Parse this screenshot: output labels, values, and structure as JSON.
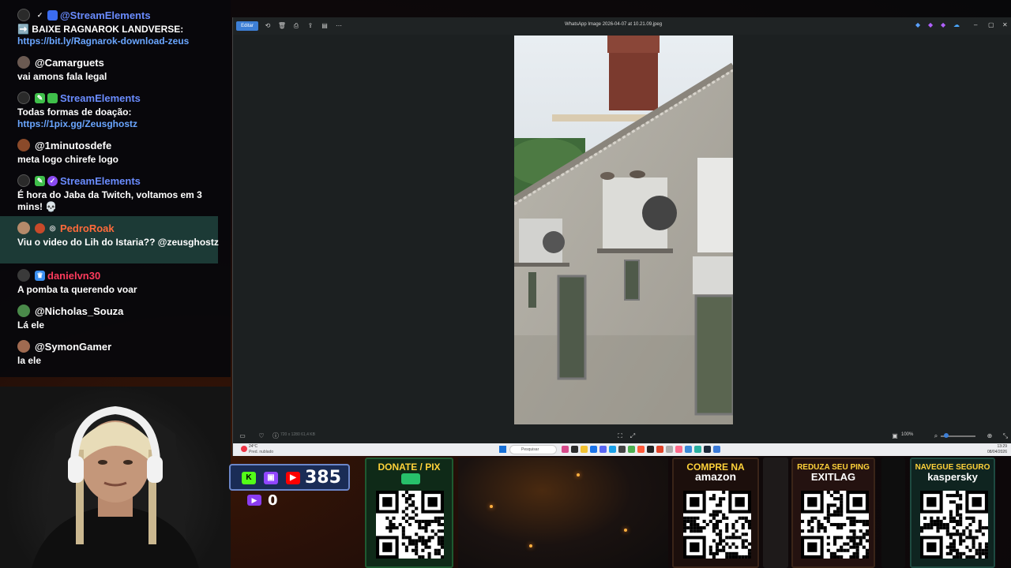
{
  "chat": {
    "messages": [
      {
        "user": "@StreamElements",
        "user_color": "#6a8cff",
        "text": "➡️ BAIXE RAGNAROK LANDVERSE:",
        "link": "https://bit.ly/Ragnarok-download-zeus"
      },
      {
        "user": "@Camarguets",
        "user_color": "#ffffff",
        "text": "vai amons fala legal",
        "link": ""
      },
      {
        "user": "StreamElements",
        "user_color": "#6a8cff",
        "text": "Todas formas de doação:",
        "link": "https://1pix.gg/Zeusghostz"
      },
      {
        "user": "@1minutosdefe",
        "user_color": "#ffffff",
        "text": "meta logo chirefe logo",
        "link": ""
      },
      {
        "user": "StreamElements",
        "user_color": "#6a8cff",
        "text": "É hora do Jaba da Twitch, voltamos em 3 mins! 💀",
        "link": ""
      },
      {
        "user": "PedroRoak",
        "user_color": "#ff6a3a",
        "text": "Viu o video do Lih do Istaria?? @zeusghostz",
        "link": ""
      },
      {
        "user": "danielvn30",
        "user_color": "#ff3b5c",
        "text": "A pomba ta querendo voar",
        "link": ""
      },
      {
        "user": "@Nicholas_Souza",
        "user_color": "#ffffff",
        "text": "Lá ele",
        "link": ""
      },
      {
        "user": "@SymonGamer",
        "user_color": "#ffffff",
        "text": "la ele",
        "link": ""
      }
    ]
  },
  "viewer": {
    "edit_label": "Editar",
    "file_title": "WhatsApp Image 2026-04-07 at 10.21.09.jpeg",
    "dims": "720 x 1280   61,4 KB",
    "zoom": "100%"
  },
  "taskbar": {
    "temp": "24°C",
    "weather": "Pred. nublado",
    "search_placeholder": "Pesquisar",
    "time": "13:29",
    "date": "08/04/2026"
  },
  "counters": {
    "subs": "385",
    "members": "0"
  },
  "cards": {
    "donate": "DONATE / PIX",
    "amazon_line1": "COMPRE NA",
    "amazon_line2": "amazon",
    "exitlag_line1": "REDUZA SEU PING",
    "exitlag_line2": "EXITLAG",
    "kaspersky_line1": "NAVEGUE SEGURO",
    "kaspersky_line2": "kaspersky"
  },
  "colors": {
    "accent_blue": "#3d7fd6",
    "link": "#6aa6ff",
    "card_yellow": "#ffd23a"
  }
}
